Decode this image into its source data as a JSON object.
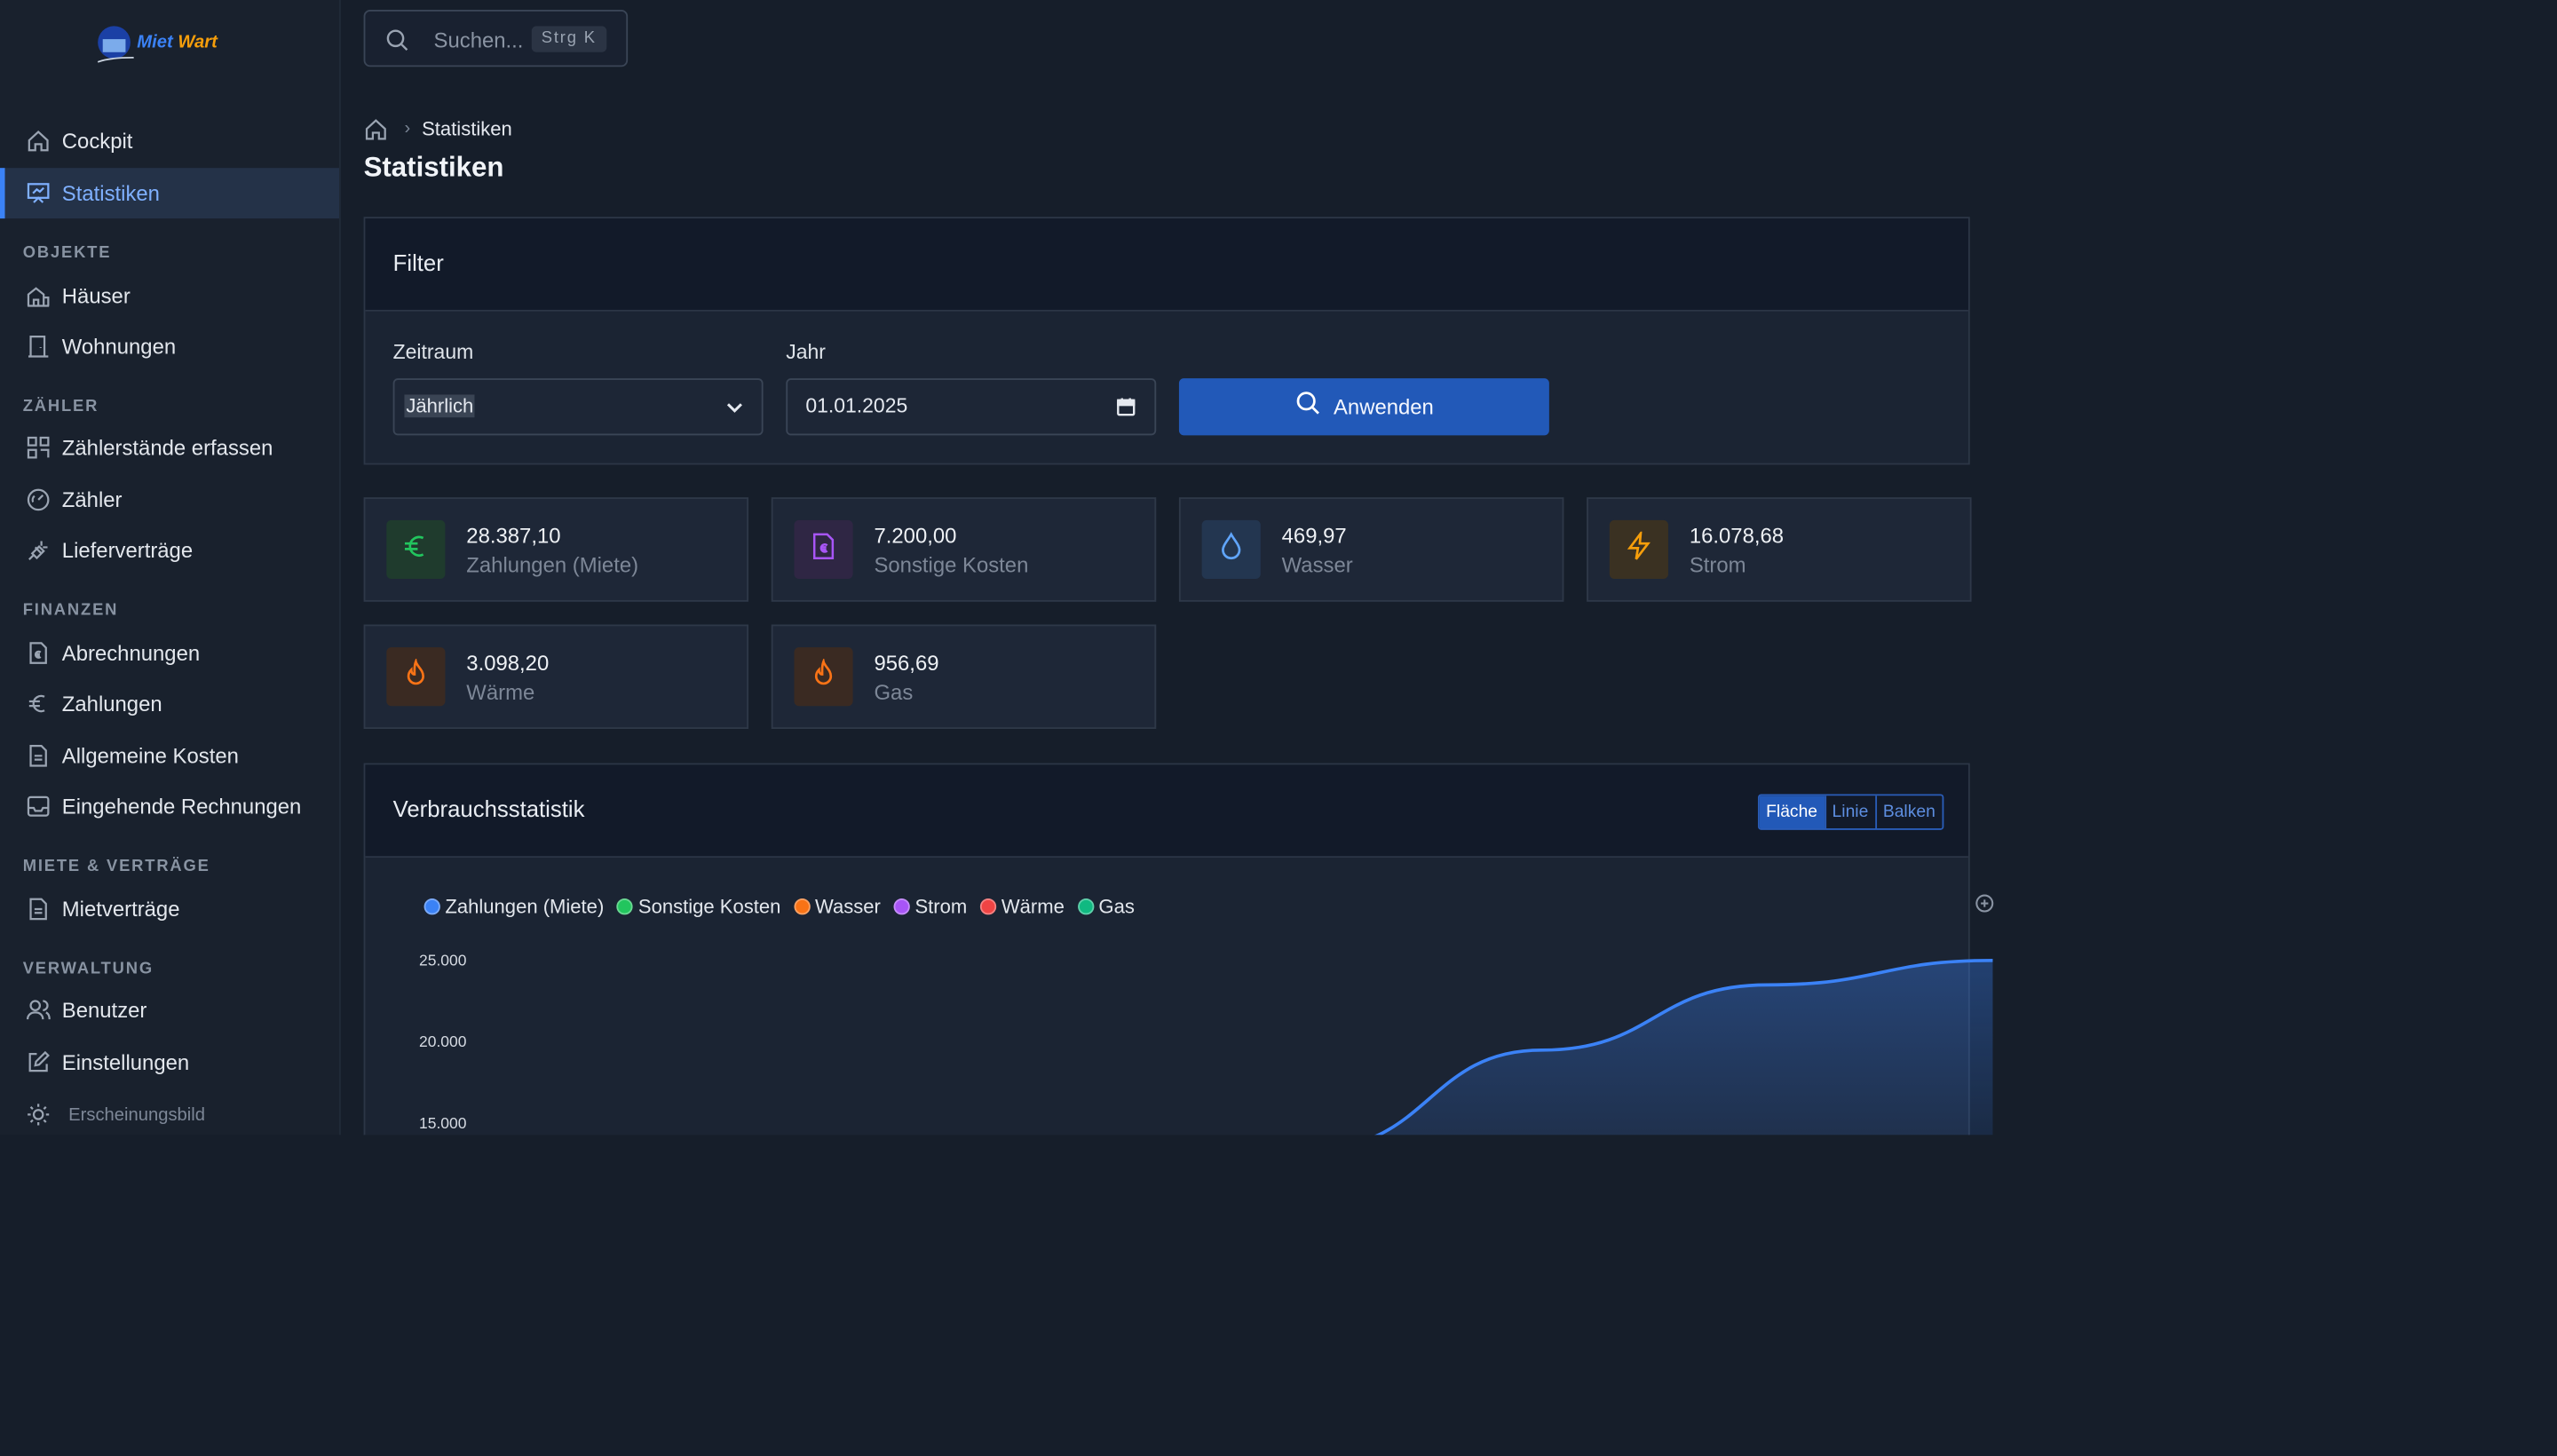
{
  "app": {
    "logo": {
      "part1": "Miet",
      "part2": "Wart"
    }
  },
  "sidebar": {
    "items_top": [
      {
        "label": "Cockpit",
        "icon": "home-icon"
      },
      {
        "label": "Statistiken",
        "icon": "presentation-chart-icon",
        "active": true
      }
    ],
    "sections": [
      {
        "title": "OBJEKTE",
        "items": [
          {
            "label": "Häuser",
            "icon": "building-icon"
          },
          {
            "label": "Wohnungen",
            "icon": "door-icon"
          }
        ]
      },
      {
        "title": "ZÄHLER",
        "items": [
          {
            "label": "Zählerstände erfassen",
            "icon": "grid-icon"
          },
          {
            "label": "Zähler",
            "icon": "gauge-icon"
          },
          {
            "label": "Lieferverträge",
            "icon": "plug-icon"
          }
        ]
      },
      {
        "title": "FINANZEN",
        "items": [
          {
            "label": "Abrechnungen",
            "icon": "receipt-icon"
          },
          {
            "label": "Zahlungen",
            "icon": "euro-icon"
          },
          {
            "label": "Allgemeine Kosten",
            "icon": "document-icon"
          },
          {
            "label": "Eingehende Rechnungen",
            "icon": "inbox-icon"
          }
        ]
      },
      {
        "title": "MIETE & VERTRÄGE",
        "items": [
          {
            "label": "Mietverträge",
            "icon": "contract-icon"
          }
        ]
      },
      {
        "title": "VERWALTUNG",
        "items": [
          {
            "label": "Benutzer",
            "icon": "users-icon"
          },
          {
            "label": "Einstellungen",
            "icon": "edit-icon"
          }
        ]
      }
    ],
    "appearance": {
      "label": "Erscheinungsbild",
      "icon": "sun-icon"
    }
  },
  "search": {
    "placeholder": "Suchen...",
    "shortcut": "Strg K"
  },
  "breadcrumb": {
    "current": "Statistiken"
  },
  "page": {
    "title": "Statistiken"
  },
  "filter": {
    "title": "Filter",
    "period_label": "Zeitraum",
    "period_value": "Jährlich",
    "year_label": "Jahr",
    "year_value": "01.01.2025",
    "apply_label": "Anwenden"
  },
  "stats": [
    {
      "value": "28.387,10",
      "label": "Zahlungen (Miete)",
      "icon": "euro-icon",
      "color": "#22c55e",
      "bg": "#1f3b2d"
    },
    {
      "value": "7.200,00",
      "label": "Sonstige Kosten",
      "icon": "invoice-icon",
      "color": "#a855f7",
      "bg": "#2f2644"
    },
    {
      "value": "469,97",
      "label": "Wasser",
      "icon": "droplet-icon",
      "color": "#60a5fa",
      "bg": "#233650"
    },
    {
      "value": "16.078,68",
      "label": "Strom",
      "icon": "bolt-icon",
      "color": "#f59e0b",
      "bg": "#3a3122"
    },
    {
      "value": "3.098,20",
      "label": "Wärme",
      "icon": "flame-icon",
      "color": "#f97316",
      "bg": "#3a2a22"
    },
    {
      "value": "956,69",
      "label": "Gas",
      "icon": "flame-icon",
      "color": "#f97316",
      "bg": "#3a2a22"
    }
  ],
  "consumption": {
    "title": "Verbrauchsstatistik",
    "views": [
      "Fläche",
      "Linie",
      "Balken"
    ],
    "active_view": "Fläche"
  },
  "chart_data": {
    "type": "area",
    "series": [
      {
        "name": "Zahlungen (Miete)",
        "color": "#3b82f6",
        "visible_segment": {
          "x": [
            0.55,
            0.7,
            0.85,
            1.0
          ],
          "values": [
            13500,
            19500,
            23500,
            25000
          ]
        }
      },
      {
        "name": "Sonstige Kosten",
        "color": "#22c55e"
      },
      {
        "name": "Wasser",
        "color": "#f97316"
      },
      {
        "name": "Strom",
        "color": "#a855f7"
      },
      {
        "name": "Wärme",
        "color": "#ef4444"
      },
      {
        "name": "Gas",
        "color": "#10b981"
      }
    ],
    "y_ticks": [
      "25.000",
      "20.000",
      "15.000"
    ],
    "ylim": [
      15000,
      25000
    ],
    "grid": false
  }
}
